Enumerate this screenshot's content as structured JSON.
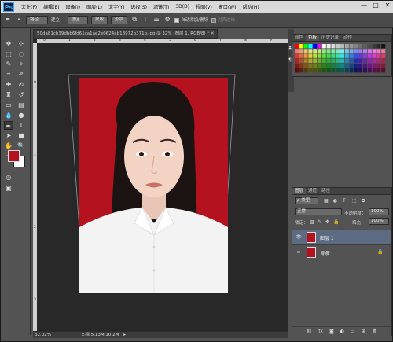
{
  "menubar": {
    "logo": "Ps",
    "items": [
      "文件(F)",
      "编辑(E)",
      "图像(I)",
      "图层(L)",
      "文字(Y)",
      "选择(S)",
      "滤镜(T)",
      "3D(D)",
      "视图(V)",
      "窗口(W)",
      "帮助(H)"
    ],
    "win_min": "—",
    "win_max": "□",
    "win_close": "✕"
  },
  "options": {
    "mode_select": "路径",
    "build_label": "建立：",
    "selection_btn": "选区…",
    "mask_btn": "蒙版",
    "shape_btn": "形状",
    "auto_add_delete": "自动添加/删除",
    "align_edges": "对齐边缘"
  },
  "document": {
    "tab_title": "50da81cb39dbb6fd61ca1ae2e0624ab18972b371b.jpg @ 32% (图层 1, RGB/8) *  ✕",
    "ruler_top_labels": [
      "0",
      "1",
      "2",
      "3",
      "4",
      "5",
      "6",
      "7",
      "8",
      "9"
    ],
    "ruler_left_labels": [
      "0",
      "1",
      "2",
      "3"
    ],
    "zoom": "32.02%",
    "doc_size": "文档:5.13M/10.2M"
  },
  "swatches": {
    "tabs": [
      "颜色",
      "色板",
      "历史记录",
      "动作"
    ],
    "active_tab": "色板"
  },
  "layers": {
    "tabs": [
      "图层",
      "通道",
      "路径"
    ],
    "kind_label": "ρ 类型",
    "blend_mode": "正常",
    "opacity_label": "不透明度：",
    "opacity_value": "100%",
    "lock_label": "锁定：",
    "fill_label": "填充：",
    "fill_value": "100%",
    "items": [
      {
        "name": "图层 1",
        "selected": true
      },
      {
        "name": "背景",
        "selected": false
      }
    ]
  },
  "colors": {
    "photo_bg": "#b5121f",
    "foreground": "#b5121f",
    "background": "#ffffff",
    "selected_layer": "#5d6b82"
  }
}
